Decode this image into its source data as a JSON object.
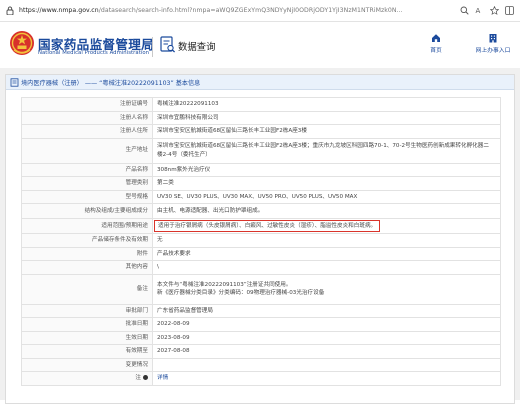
{
  "browser": {
    "url_host": "https://www.nmpa.gov.cn",
    "url_rest": "/datasearch/search-info.html?nmpa=aWQ9ZGExYmQ3NDYyNjI0ODRjODY1YjI3NzM1NTRiMzk0N..."
  },
  "header": {
    "logo_cn": "国家药品监督管理局",
    "logo_en": "National Medical Products Administration",
    "section_title": "数据查询",
    "nav": [
      {
        "label": "首页"
      },
      {
        "label": "网上办事入口"
      }
    ]
  },
  "panel": {
    "title": "境内医疗器械（注册） —— “粤械注准20222091103” 基本信息"
  },
  "record": {
    "rows": [
      {
        "key": "注册证编号",
        "value": "粤械注准20222091103"
      },
      {
        "key": "注册人名称",
        "value": "深圳市宜鹏科技有限公司"
      },
      {
        "key": "注册人住所",
        "value": "深圳市宝安区航城街道68区留仙三路长丰工业园F2栋A座3楼"
      },
      {
        "key": "生产地址",
        "value": "深圳市宝安区航城街道68区留仙三路长丰工业园F2栋A座3楼；重庆市九龙坡区科园四路70-1、70-2号生物医药创新成果转化孵化器二楼2-4号（委托生产）"
      },
      {
        "key": "产品名称",
        "value": "308nm紫外光治疗仪"
      },
      {
        "key": "管理类别",
        "value": "第二类"
      },
      {
        "key": "型号规格",
        "value": "UV30 SE、UV30 PLUS、UV30 MAX、UV50 PRO、UV50 PLUS、UV50 MAX"
      },
      {
        "key": "结构及组成/主要组成成分",
        "value": "由主机、电源适配器、出光口防护罩组成。"
      },
      {
        "key": "适用范围/预期用途",
        "value": "适用于治疗银屑病（头皮银屑病）、白癜风、过敏性皮炎（湿疹）、脂溢性皮炎和白斑病。"
      },
      {
        "key": "产品储存条件及有效期",
        "value": "无"
      },
      {
        "key": "附件",
        "value": "产品技术要求"
      },
      {
        "key": "其他内容",
        "value": "\\"
      },
      {
        "key": "备注",
        "line1": "本文件与“粤械注准20222091103”注册证共同使用。",
        "line2": "新《医疗器械分类目录》分类编码：09物理治疗器械-03光治疗设备"
      },
      {
        "key": "审批部门",
        "value": "广东省药品监督管理局"
      },
      {
        "key": "批准日期",
        "value": "2022-08-09"
      },
      {
        "key": "生效日期",
        "value": "2023-08-09"
      },
      {
        "key": "有效期至",
        "value": "2027-08-08"
      },
      {
        "key": "变更情况",
        "value": ""
      },
      {
        "key": "注",
        "value": "详情"
      }
    ]
  },
  "icons": {
    "address_lock": "lock-icon",
    "zoom": "zoom-icon",
    "favorite": "star-icon",
    "reader": "reader-icon",
    "home": "home-icon",
    "office": "building-icon",
    "query": "search-document-icon",
    "panel_head": "document-icon"
  },
  "colors": {
    "brand": "#1b4a9c",
    "highlight": "#d9342b",
    "panel_head_bg": "#e9f1fb",
    "content_bg": "#f0f0f0"
  }
}
